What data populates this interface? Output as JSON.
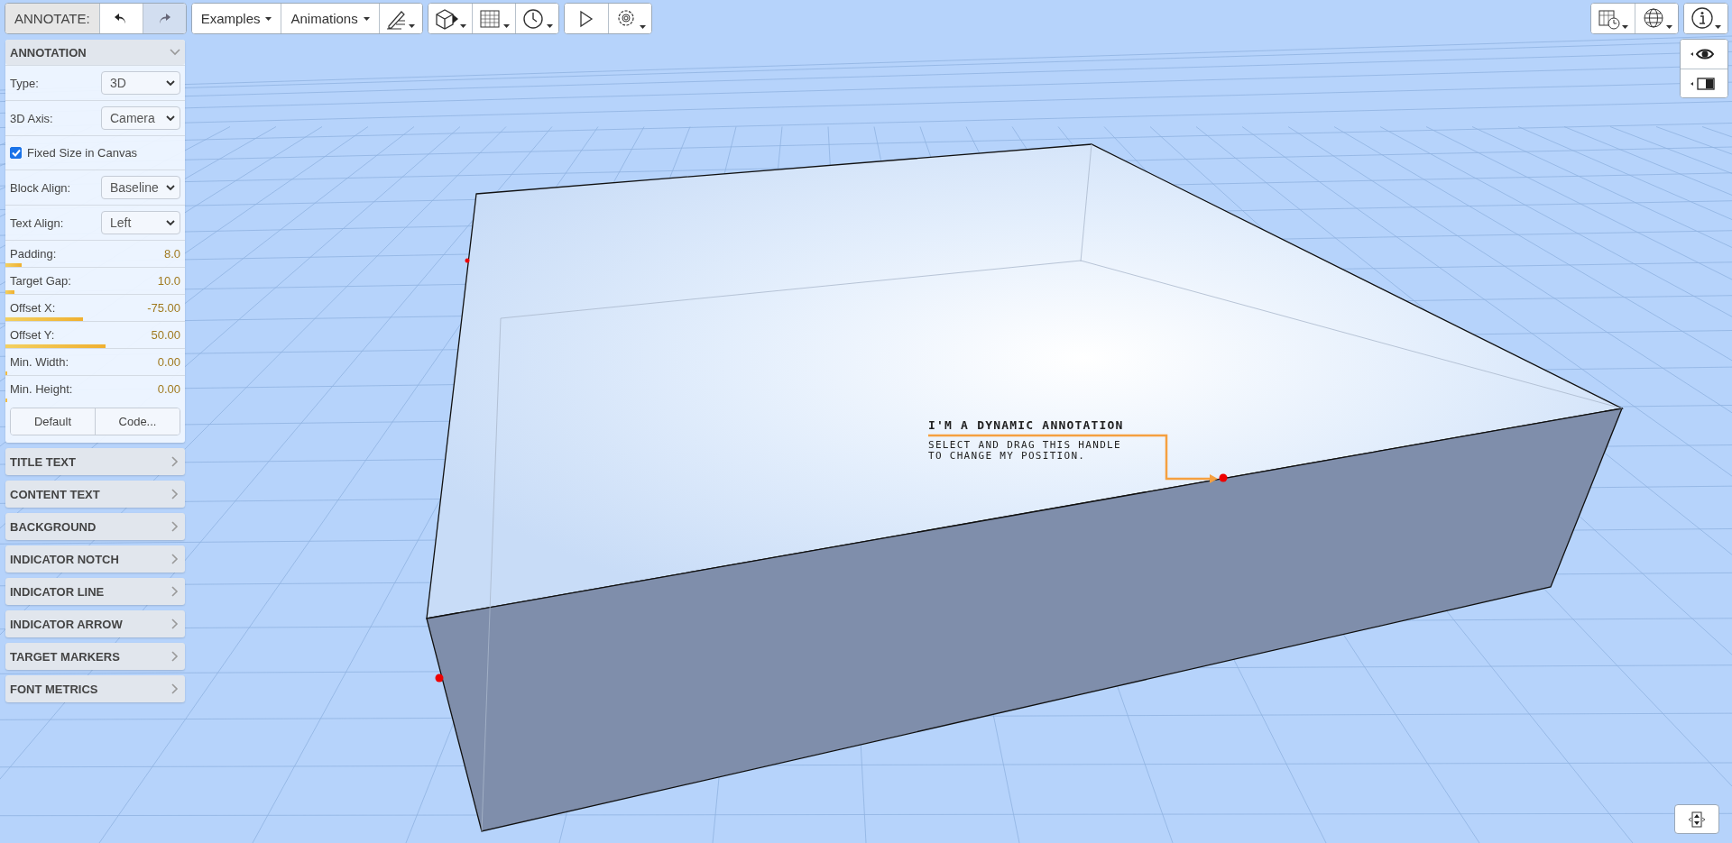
{
  "toolbar": {
    "mode_label": "ANNOTATE:",
    "undo": {
      "disabled": false
    },
    "redo": {
      "disabled": true
    },
    "menus": [
      {
        "label": "Examples"
      },
      {
        "label": "Animations"
      }
    ]
  },
  "panel": {
    "title": "ANNOTATION",
    "expanded": true,
    "rows": [
      {
        "kind": "select",
        "label": "Type:",
        "value": "3D"
      },
      {
        "kind": "select",
        "label": "3D Axis:",
        "value": "Camera"
      },
      {
        "kind": "checkbox",
        "label": "Fixed Size in Canvas",
        "checked": true
      },
      {
        "kind": "select",
        "label": "Block Align:",
        "value": "Baseline"
      },
      {
        "kind": "select",
        "label": "Text Align:",
        "value": "Left"
      },
      {
        "kind": "slider",
        "label": "Padding:",
        "reading": "8.0",
        "level": 0.09
      },
      {
        "kind": "slider",
        "label": "Target Gap:",
        "reading": "10.0",
        "level": 0.05
      },
      {
        "kind": "slider",
        "label": "Offset X:",
        "reading": "-75.00",
        "level": 0.43
      },
      {
        "kind": "slider",
        "label": "Offset Y:",
        "reading": "50.00",
        "level": 0.56
      },
      {
        "kind": "slider",
        "label": "Min. Width:",
        "reading": "0.00",
        "level": 0.01
      },
      {
        "kind": "slider",
        "label": "Min. Height:",
        "reading": "0.00",
        "level": 0.01
      }
    ],
    "buttons": [
      "Default",
      "Code..."
    ]
  },
  "sections": [
    {
      "title": "TITLE TEXT",
      "expanded": false
    },
    {
      "title": "CONTENT TEXT",
      "expanded": false
    },
    {
      "title": "BACKGROUND",
      "expanded": false
    },
    {
      "title": "INDICATOR NOTCH",
      "expanded": false
    },
    {
      "title": "INDICATOR LINE",
      "expanded": false
    },
    {
      "title": "INDICATOR ARROW",
      "expanded": false
    },
    {
      "title": "TARGET MARKERS",
      "expanded": false
    },
    {
      "title": "FONT METRICS",
      "expanded": false
    }
  ],
  "annotation": {
    "title": "I'M A DYNAMIC ANNOTATION",
    "lines": [
      "SELECT AND DRAG THIS HANDLE",
      "TO CHANGE MY POSITION."
    ]
  }
}
